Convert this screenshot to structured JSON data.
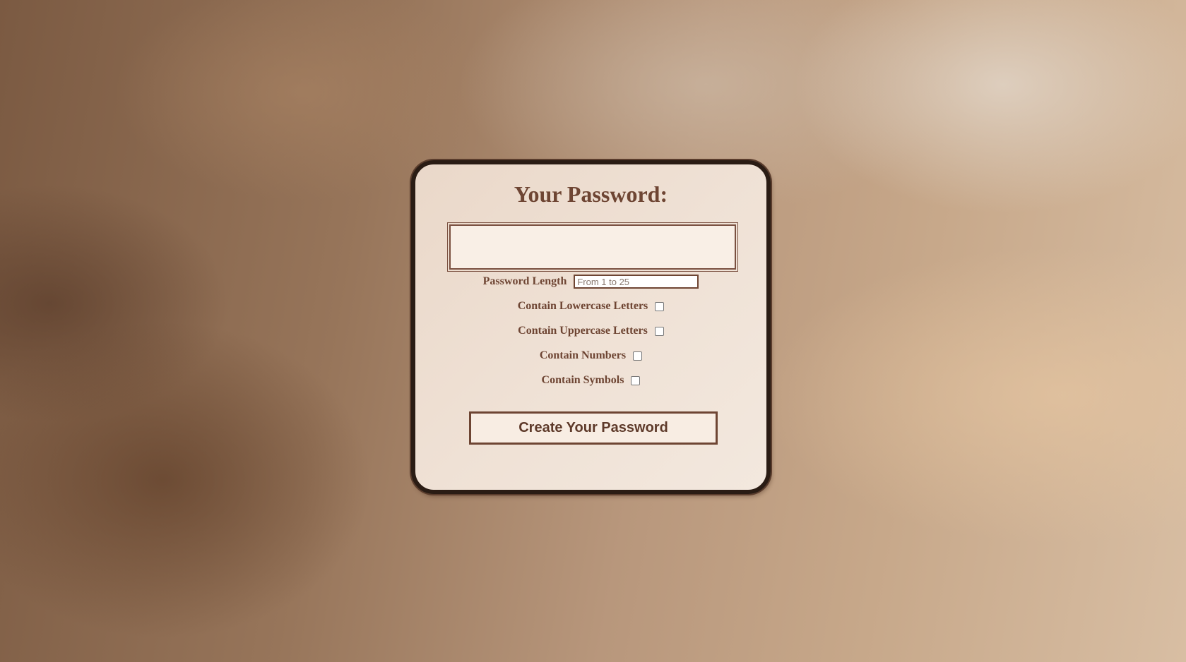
{
  "card": {
    "title": "Your Password:",
    "output_value": ""
  },
  "length": {
    "label": "Password Length",
    "placeholder": "From 1 to 25",
    "value": ""
  },
  "options": [
    {
      "label": "Contain Lowercase Letters",
      "checked": false
    },
    {
      "label": "Contain Uppercase Letters",
      "checked": false
    },
    {
      "label": "Contain Numbers",
      "checked": false
    },
    {
      "label": "Contain Symbols",
      "checked": false
    }
  ],
  "button": {
    "label": "Create Your Password"
  },
  "colors": {
    "text": "#6e4533",
    "card_border": "#2a1c14",
    "card_background": "#efe1d5",
    "input_background": "#f9efe6"
  }
}
